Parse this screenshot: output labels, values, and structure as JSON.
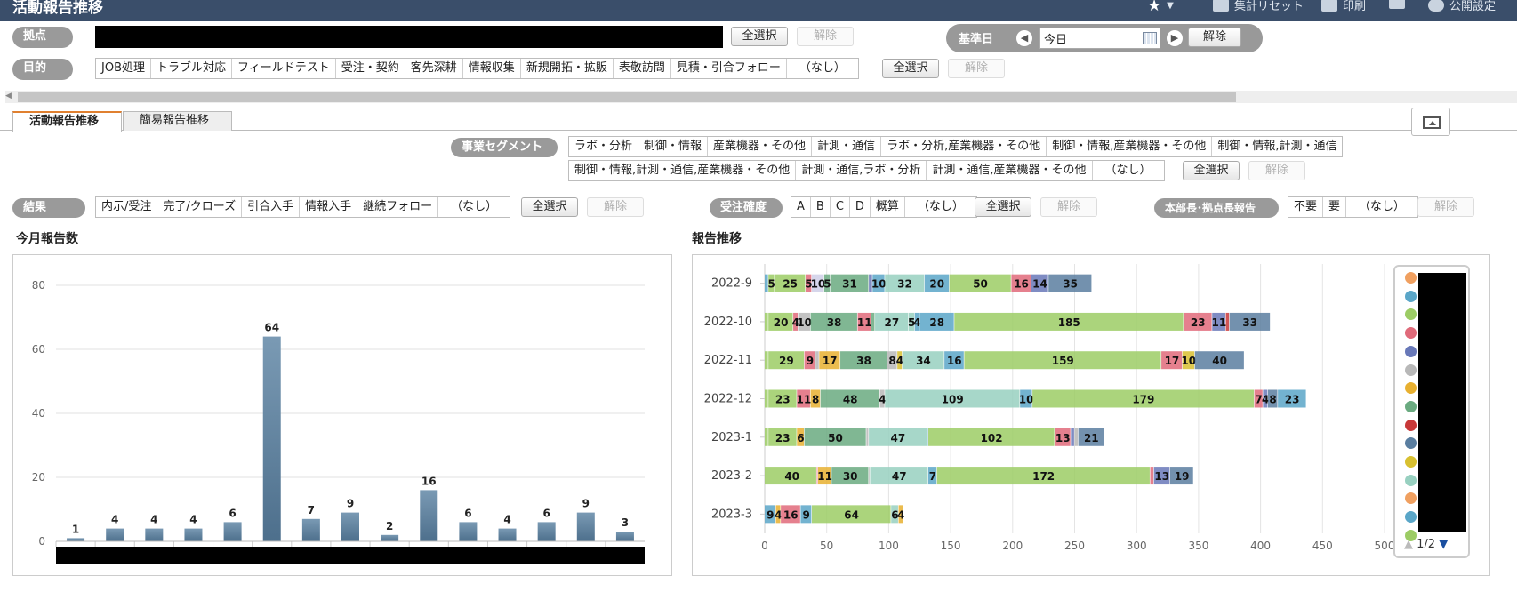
{
  "header": {
    "title": "活動報告推移",
    "tools": [
      {
        "label": "集計リセット",
        "icon": "reset-icon"
      },
      {
        "label": "印刷",
        "icon": "print-icon"
      },
      {
        "label": "",
        "icon": "xlsx-icon"
      },
      {
        "label": "公開設定",
        "icon": "user-icon"
      }
    ]
  },
  "filters": {
    "kyoten": {
      "label": "拠点",
      "select_all": "全選択",
      "clear": "解除"
    },
    "kijunbi": {
      "label": "基準日",
      "value": "今日",
      "clear": "解除"
    },
    "mokuteki": {
      "label": "目的",
      "options": [
        "JOB処理",
        "トラブル対応",
        "フィールドテスト",
        "受注・契約",
        "客先深耕",
        "情報収集",
        "新規開拓・拡販",
        "表敬訪問",
        "見積・引合フォロー",
        "（なし）"
      ],
      "select_all": "全選択",
      "clear": "解除"
    },
    "segment": {
      "label": "事業セグメント",
      "row1": [
        "ラボ・分析",
        "制御・情報",
        "産業機器・その他",
        "計測・通信",
        "ラボ・分析,産業機器・その他",
        "制御・情報,産業機器・その他",
        "制御・情報,計測・通信"
      ],
      "row2": [
        "制御・情報,計測・通信,産業機器・その他",
        "計測・通信,ラボ・分析",
        "計測・通信,産業機器・その他",
        "（なし）"
      ],
      "select_all": "全選択",
      "clear": "解除"
    },
    "kekka": {
      "label": "結果",
      "options": [
        "内示/受注",
        "完了/クローズ",
        "引合入手",
        "情報入手",
        "継続フォロー",
        "（なし）"
      ],
      "select_all": "全選択",
      "clear": "解除"
    },
    "juchu": {
      "label": "受注確度",
      "options": [
        "A",
        "B",
        "C",
        "D",
        "概算",
        "（なし）"
      ],
      "select_all": "全選択",
      "clear": "解除"
    },
    "honbucho": {
      "label": "本部長･拠点長報告",
      "options": [
        "不要",
        "要",
        "（なし）"
      ],
      "clear": "解除"
    }
  },
  "tabs": [
    {
      "label": "活動報告推移",
      "active": true
    },
    {
      "label": "簡易報告推移",
      "active": false
    }
  ],
  "left_chart": {
    "title": "今月報告数"
  },
  "right_chart": {
    "title": "報告推移"
  },
  "legend": {
    "pager": "1/2",
    "colors": [
      "#f0a060",
      "#5aa6c8",
      "#9ccc65",
      "#e06a7a",
      "#6878b8",
      "#b8b8b8",
      "#e8b030",
      "#6aaa80",
      "#c83838",
      "#5a7ea0",
      "#d8c030",
      "#98d0c0",
      "#f0a060",
      "#5aa6c8",
      "#9ccc65"
    ]
  },
  "chart_data": [
    {
      "type": "bar",
      "title": "今月報告数",
      "categories": [
        "",
        "",
        "",
        "",
        "",
        "",
        "",
        "",
        "",
        "",
        "",
        "",
        "",
        "",
        ""
      ],
      "values": [
        1,
        4,
        4,
        4,
        6,
        64,
        7,
        9,
        2,
        16,
        6,
        4,
        6,
        9,
        3
      ],
      "ylim": [
        0,
        80
      ],
      "yticks": [
        0,
        20,
        40,
        60,
        80
      ],
      "grid": true
    },
    {
      "type": "bar",
      "orientation": "horizontal",
      "stacked": true,
      "title": "報告推移",
      "categories": [
        "2022-9",
        "2022-10",
        "2022-11",
        "2022-12",
        "2023-1",
        "2023-2",
        "2023-3"
      ],
      "xlim": [
        0,
        500
      ],
      "xticks": [
        0,
        50,
        100,
        150,
        200,
        250,
        300,
        350,
        400,
        450,
        500
      ],
      "grid": true,
      "rows": [
        [
          {
            "v": 3,
            "c": "#5aa6c8"
          },
          {
            "v": 5,
            "c": "#9ccc65"
          },
          {
            "v": 25,
            "c": "#9ccc65"
          },
          {
            "v": 5,
            "c": "#e06a7a"
          },
          {
            "v": 10,
            "c": "#cfcfe8"
          },
          {
            "v": 5,
            "c": "#6aaa80"
          },
          {
            "v": 31,
            "c": "#6aaa80"
          },
          {
            "v": 3,
            "c": "#6878b8"
          },
          {
            "v": 10,
            "c": "#5aa6c8"
          },
          {
            "v": 32,
            "c": "#98d0c0"
          },
          {
            "v": 20,
            "c": "#5aa6c8"
          },
          {
            "v": 50,
            "c": "#9ccc65"
          },
          {
            "v": 16,
            "c": "#e06a7a"
          },
          {
            "v": 14,
            "c": "#6878b8"
          },
          {
            "v": 35,
            "c": "#5a7ea0"
          }
        ],
        [
          {
            "v": 3,
            "c": "#9ccc65"
          },
          {
            "v": 20,
            "c": "#9ccc65"
          },
          {
            "v": 4,
            "c": "#e06a7a"
          },
          {
            "v": 10,
            "c": "#b8b8b8"
          },
          {
            "v": 38,
            "c": "#6aaa80"
          },
          {
            "v": 11,
            "c": "#e06a7a"
          },
          {
            "v": 3,
            "c": "#6aaa80"
          },
          {
            "v": 27,
            "c": "#98d0c0"
          },
          {
            "v": 5,
            "c": "#98d0c0"
          },
          {
            "v": 4,
            "c": "#5aa6c8"
          },
          {
            "v": 28,
            "c": "#5aa6c8"
          },
          {
            "v": 185,
            "c": "#9ccc65"
          },
          {
            "v": 23,
            "c": "#e06a7a"
          },
          {
            "v": 11,
            "c": "#6878b8"
          },
          {
            "v": 3,
            "c": "#c83838"
          },
          {
            "v": 33,
            "c": "#5a7ea0"
          }
        ],
        [
          {
            "v": 3,
            "c": "#9ccc65"
          },
          {
            "v": 29,
            "c": "#9ccc65"
          },
          {
            "v": 9,
            "c": "#e06a7a"
          },
          {
            "v": 3,
            "c": "#b8b8b8"
          },
          {
            "v": 17,
            "c": "#e8b030"
          },
          {
            "v": 38,
            "c": "#6aaa80"
          },
          {
            "v": 8,
            "c": "#b8b8b8"
          },
          {
            "v": 4,
            "c": "#d8c030"
          },
          {
            "v": 34,
            "c": "#98d0c0"
          },
          {
            "v": 16,
            "c": "#5aa6c8"
          },
          {
            "v": 159,
            "c": "#9ccc65"
          },
          {
            "v": 17,
            "c": "#e06a7a"
          },
          {
            "v": 10,
            "c": "#d8c030"
          },
          {
            "v": 40,
            "c": "#5a7ea0"
          }
        ],
        [
          {
            "v": 3,
            "c": "#9ccc65"
          },
          {
            "v": 23,
            "c": "#9ccc65"
          },
          {
            "v": 11,
            "c": "#e06a7a"
          },
          {
            "v": 8,
            "c": "#e8b030"
          },
          {
            "v": 48,
            "c": "#6aaa80"
          },
          {
            "v": 4,
            "c": "#b8b8b8"
          },
          {
            "v": 109,
            "c": "#98d0c0"
          },
          {
            "v": 10,
            "c": "#5aa6c8"
          },
          {
            "v": 179,
            "c": "#9ccc65"
          },
          {
            "v": 7,
            "c": "#e06a7a"
          },
          {
            "v": 4,
            "c": "#6878b8"
          },
          {
            "v": 8,
            "c": "#5a7ea0"
          },
          {
            "v": 23,
            "c": "#5aa6c8"
          }
        ],
        [
          {
            "v": 3,
            "c": "#9ccc65"
          },
          {
            "v": 23,
            "c": "#9ccc65"
          },
          {
            "v": 6,
            "c": "#e8b030"
          },
          {
            "v": 50,
            "c": "#6aaa80"
          },
          {
            "v": 2,
            "c": "#b8b8b8"
          },
          {
            "v": 47,
            "c": "#98d0c0"
          },
          {
            "v": 1,
            "c": "#5aa6c8"
          },
          {
            "v": 102,
            "c": "#9ccc65"
          },
          {
            "v": 13,
            "c": "#e06a7a"
          },
          {
            "v": 3,
            "c": "#6878b8"
          },
          {
            "v": 3,
            "c": "#b8b8b8"
          },
          {
            "v": 21,
            "c": "#5a7ea0"
          }
        ],
        [
          {
            "v": 2,
            "c": "#9ccc65"
          },
          {
            "v": 40,
            "c": "#9ccc65"
          },
          {
            "v": 1,
            "c": "#e06a7a"
          },
          {
            "v": 11,
            "c": "#e8b030"
          },
          {
            "v": 30,
            "c": "#6aaa80"
          },
          {
            "v": 1,
            "c": "#b8b8b8"
          },
          {
            "v": 47,
            "c": "#98d0c0"
          },
          {
            "v": 7,
            "c": "#5aa6c8"
          },
          {
            "v": 172,
            "c": "#9ccc65"
          },
          {
            "v": 3,
            "c": "#e06a7a"
          },
          {
            "v": 13,
            "c": "#6878b8"
          },
          {
            "v": 19,
            "c": "#5a7ea0"
          }
        ],
        [
          {
            "v": 9,
            "c": "#5aa6c8"
          },
          {
            "v": 4,
            "c": "#e8b030"
          },
          {
            "v": 16,
            "c": "#e06a7a"
          },
          {
            "v": 9,
            "c": "#5aa6c8"
          },
          {
            "v": 64,
            "c": "#9ccc65"
          },
          {
            "v": 6,
            "c": "#98d0c0"
          },
          {
            "v": 4,
            "c": "#e8b030"
          }
        ]
      ]
    }
  ]
}
